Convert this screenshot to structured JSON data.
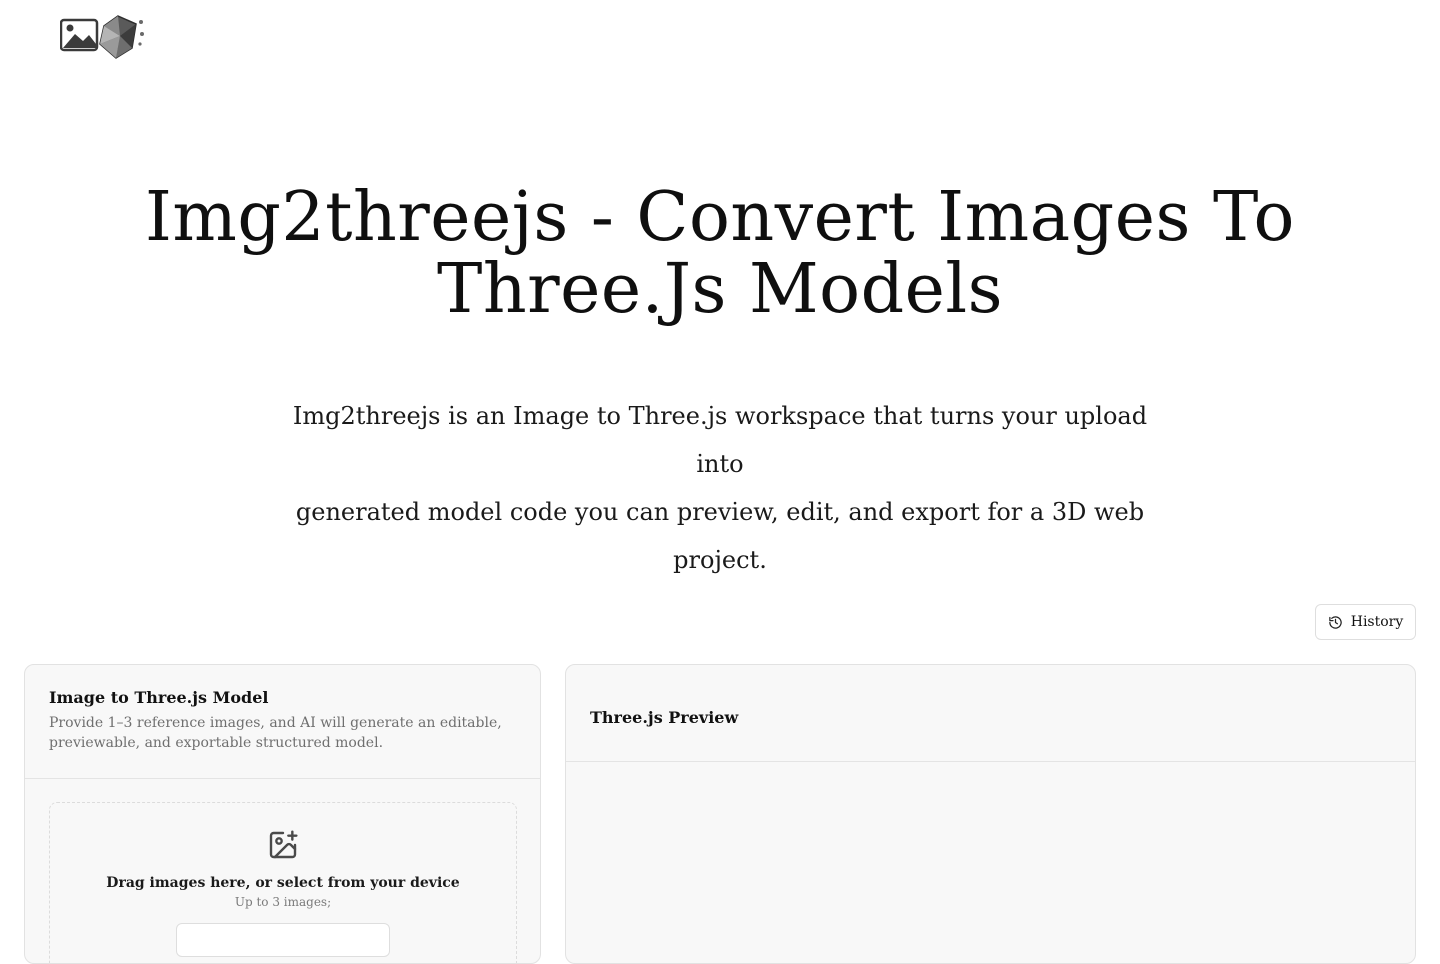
{
  "header": {
    "logo_icon": "image-to-3d-logo-icon"
  },
  "hero": {
    "title_line1": "Img2threejs - Convert Images To",
    "title_line2": "Three.Js Models",
    "subtitle_line1": "Img2threejs is an Image to Three.js workspace that turns your upload into",
    "subtitle_line2": "generated model code you can preview, edit, and export for a 3D web project."
  },
  "toolbar": {
    "history_label": "History",
    "history_icon": "history-icon"
  },
  "left_panel": {
    "title": "Image to Three.js Model",
    "description": "Provide 1–3 reference images, and AI will generate an editable, previewable, and exportable structured model.",
    "dropzone": {
      "icon": "image-plus-icon",
      "text": "Drag images here, or select from your device",
      "hint": "Up to 3 images;"
    }
  },
  "right_panel": {
    "title": "Three.js Preview"
  }
}
